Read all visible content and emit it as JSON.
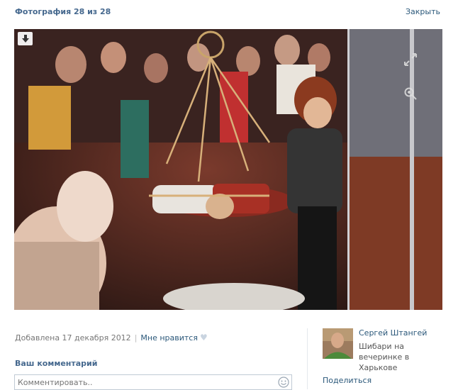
{
  "viewer": {
    "title": "Фотография 28 из 28",
    "close_label": "Закрыть"
  },
  "photo": {
    "icons": [
      "download-icon",
      "fullscreen-icon",
      "zoom-icon"
    ]
  },
  "meta": {
    "added": "Добавлена 17 декабря 2012",
    "like_label": "Мне нравится",
    "like_icon": "heart-icon"
  },
  "comment": {
    "label": "Ваш комментарий",
    "placeholder": "Комментировать.."
  },
  "author": {
    "name": "Сергей Штангей",
    "description": "Шибари на вечеринке в Харькове"
  },
  "share_label": "Поделиться",
  "colors": {
    "link": "#2b587a",
    "title": "#45688e",
    "border": "#c0cad5"
  }
}
